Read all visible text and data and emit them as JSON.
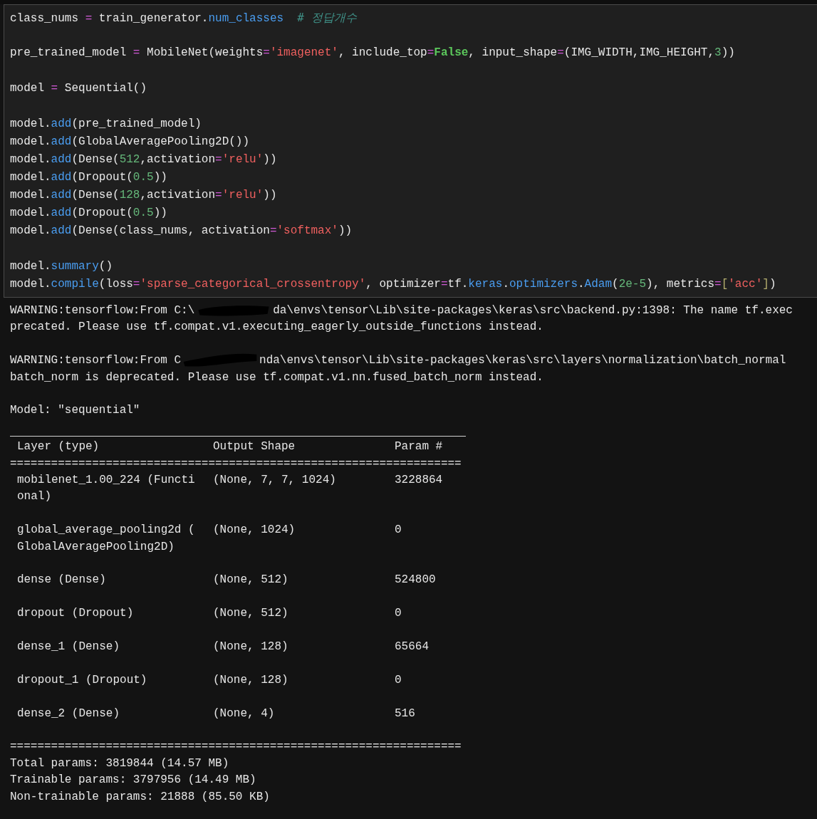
{
  "code_cell": {
    "lines": [
      {
        "kind": "code",
        "tokens": [
          {
            "kind": "plain",
            "text": "class_nums "
          },
          {
            "kind": "op",
            "text": "="
          },
          {
            "kind": "plain",
            "text": " train_generator."
          },
          {
            "kind": "attr",
            "text": "num_classes"
          },
          {
            "kind": "comment",
            "text": "# 정답개수"
          }
        ]
      },
      {
        "kind": "blank"
      },
      {
        "kind": "code",
        "tokens": [
          {
            "kind": "plain",
            "text": "pre_trained_model "
          },
          {
            "kind": "op",
            "text": "="
          },
          {
            "kind": "plain",
            "text": " MobileNet(weights"
          },
          {
            "kind": "op",
            "text": "="
          },
          {
            "kind": "str",
            "text": "'imagenet'"
          },
          {
            "kind": "plain",
            "text": ", include_top"
          },
          {
            "kind": "op",
            "text": "="
          },
          {
            "kind": "kw",
            "text": "False"
          },
          {
            "kind": "plain",
            "text": ", input_shape"
          },
          {
            "kind": "op",
            "text": "="
          },
          {
            "kind": "plain",
            "text": "(IMG_WIDTH,IMG_HEIGHT,"
          },
          {
            "kind": "num",
            "text": "3"
          },
          {
            "kind": "plain",
            "text": "))"
          }
        ]
      },
      {
        "kind": "blank"
      },
      {
        "kind": "code",
        "tokens": [
          {
            "kind": "plain",
            "text": "model "
          },
          {
            "kind": "op",
            "text": "="
          },
          {
            "kind": "plain",
            "text": " Sequential()"
          }
        ]
      },
      {
        "kind": "blank"
      },
      {
        "kind": "code",
        "tokens": [
          {
            "kind": "plain",
            "text": "model."
          },
          {
            "kind": "attr",
            "text": "add"
          },
          {
            "kind": "plain",
            "text": "(pre_trained_model)"
          }
        ]
      },
      {
        "kind": "code",
        "tokens": [
          {
            "kind": "plain",
            "text": "model."
          },
          {
            "kind": "attr",
            "text": "add"
          },
          {
            "kind": "plain",
            "text": "(GlobalAveragePooling2D())"
          }
        ]
      },
      {
        "kind": "code",
        "tokens": [
          {
            "kind": "plain",
            "text": "model."
          },
          {
            "kind": "attr",
            "text": "add"
          },
          {
            "kind": "plain",
            "text": "(Dense("
          },
          {
            "kind": "num",
            "text": "512"
          },
          {
            "kind": "plain",
            "text": ",activation"
          },
          {
            "kind": "op",
            "text": "="
          },
          {
            "kind": "str",
            "text": "'relu'"
          },
          {
            "kind": "plain",
            "text": "))"
          }
        ]
      },
      {
        "kind": "code",
        "tokens": [
          {
            "kind": "plain",
            "text": "model."
          },
          {
            "kind": "attr",
            "text": "add"
          },
          {
            "kind": "plain",
            "text": "(Dropout("
          },
          {
            "kind": "num",
            "text": "0.5"
          },
          {
            "kind": "plain",
            "text": "))"
          }
        ]
      },
      {
        "kind": "code",
        "tokens": [
          {
            "kind": "plain",
            "text": "model."
          },
          {
            "kind": "attr",
            "text": "add"
          },
          {
            "kind": "plain",
            "text": "(Dense("
          },
          {
            "kind": "num",
            "text": "128"
          },
          {
            "kind": "plain",
            "text": ",activation"
          },
          {
            "kind": "op",
            "text": "="
          },
          {
            "kind": "str",
            "text": "'relu'"
          },
          {
            "kind": "plain",
            "text": "))"
          }
        ]
      },
      {
        "kind": "code",
        "tokens": [
          {
            "kind": "plain",
            "text": "model."
          },
          {
            "kind": "attr",
            "text": "add"
          },
          {
            "kind": "plain",
            "text": "(Dropout("
          },
          {
            "kind": "num",
            "text": "0.5"
          },
          {
            "kind": "plain",
            "text": "))"
          }
        ]
      },
      {
        "kind": "code",
        "tokens": [
          {
            "kind": "plain",
            "text": "model."
          },
          {
            "kind": "attr",
            "text": "add"
          },
          {
            "kind": "plain",
            "text": "(Dense(class_nums, activation"
          },
          {
            "kind": "op",
            "text": "="
          },
          {
            "kind": "str",
            "text": "'softmax'"
          },
          {
            "kind": "plain",
            "text": "))"
          }
        ]
      },
      {
        "kind": "blank"
      },
      {
        "kind": "code",
        "tokens": [
          {
            "kind": "plain",
            "text": "model."
          },
          {
            "kind": "attr",
            "text": "summary"
          },
          {
            "kind": "plain",
            "text": "()"
          }
        ]
      },
      {
        "kind": "code",
        "tokens": [
          {
            "kind": "plain",
            "text": "model."
          },
          {
            "kind": "attr",
            "text": "compile"
          },
          {
            "kind": "plain",
            "text": "(loss"
          },
          {
            "kind": "op",
            "text": "="
          },
          {
            "kind": "str",
            "text": "'sparse_categorical_crossentropy'"
          },
          {
            "kind": "plain",
            "text": ", optimizer"
          },
          {
            "kind": "op",
            "text": "="
          },
          {
            "kind": "plain",
            "text": "tf."
          },
          {
            "kind": "attr",
            "text": "keras"
          },
          {
            "kind": "plain",
            "text": "."
          },
          {
            "kind": "attr",
            "text": "optimizers"
          },
          {
            "kind": "plain",
            "text": "."
          },
          {
            "kind": "attr",
            "text": "Adam"
          },
          {
            "kind": "plain",
            "text": "("
          },
          {
            "kind": "num",
            "text": "2e-5"
          },
          {
            "kind": "plain",
            "text": "), metrics"
          },
          {
            "kind": "op",
            "text": "="
          },
          {
            "kind": "bracket",
            "text": "["
          },
          {
            "kind": "str",
            "text": "'acc'"
          },
          {
            "kind": "bracket",
            "text": "]"
          },
          {
            "kind": "plain",
            "text": ")"
          }
        ]
      }
    ]
  },
  "output": {
    "warnings": [
      {
        "head": "WARNING:tensorflow:From C:\\",
        "tail": "da\\envs\\tensor\\Lib\\site-packages\\keras\\src\\backend.py:1398: The name tf.exec",
        "continued": "precated. Please use tf.compat.v1.executing_eagerly_outside_functions instead."
      },
      {
        "head": "WARNING:tensorflow:From C",
        "tail": "nda\\envs\\tensor\\Lib\\site-packages\\keras\\src\\layers\\normalization\\batch_normal",
        "continued": "batch_norm is deprecated. Please use tf.compat.v1.nn.fused_batch_norm instead."
      }
    ],
    "model_line": "Model: \"sequential\"",
    "summary": {
      "columns": [
        "Layer (type)",
        "Output Shape",
        "Param #"
      ],
      "separator": "==================================================================",
      "rows": [
        [
          "mobilenet_1.00_224 (Functional)",
          "(None, 7, 7, 1024)",
          "3228864"
        ],
        [
          "global_average_pooling2d (GlobalAveragePooling2D)",
          "(None, 1024)",
          "0"
        ],
        [
          "dense (Dense)",
          "(None, 512)",
          "524800"
        ],
        [
          "dropout (Dropout)",
          "(None, 512)",
          "0"
        ],
        [
          "dense_1 (Dense)",
          "(None, 128)",
          "65664"
        ],
        [
          "dropout_1 (Dropout)",
          "(None, 128)",
          "0"
        ],
        [
          "dense_2 (Dense)",
          "(None, 4)",
          "516"
        ]
      ],
      "totals": [
        "Total params: 3819844 (14.57 MB)",
        "Trainable params: 3797956 (14.49 MB)",
        "Non-trainable params: 21888 (85.50 KB)"
      ]
    }
  }
}
